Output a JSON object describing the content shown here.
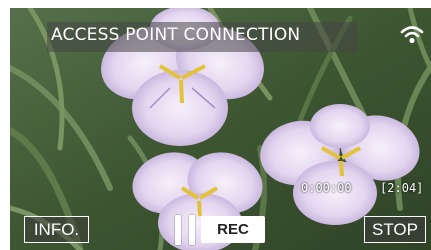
{
  "header": {
    "title": "ACCESS POINT CONNECTION",
    "status_icon": "wifi-icon"
  },
  "recording": {
    "elapsed": "0:00:00",
    "remaining": "[2:04]",
    "rec_label": "REC"
  },
  "controls": {
    "info_label": "INFO.",
    "pause_icon": "pause-icon",
    "stop_label": "STOP"
  },
  "colors": {
    "overlay_text": "#ffffff",
    "foliage": "#3f5b33",
    "petal": "#e6dbf0"
  }
}
